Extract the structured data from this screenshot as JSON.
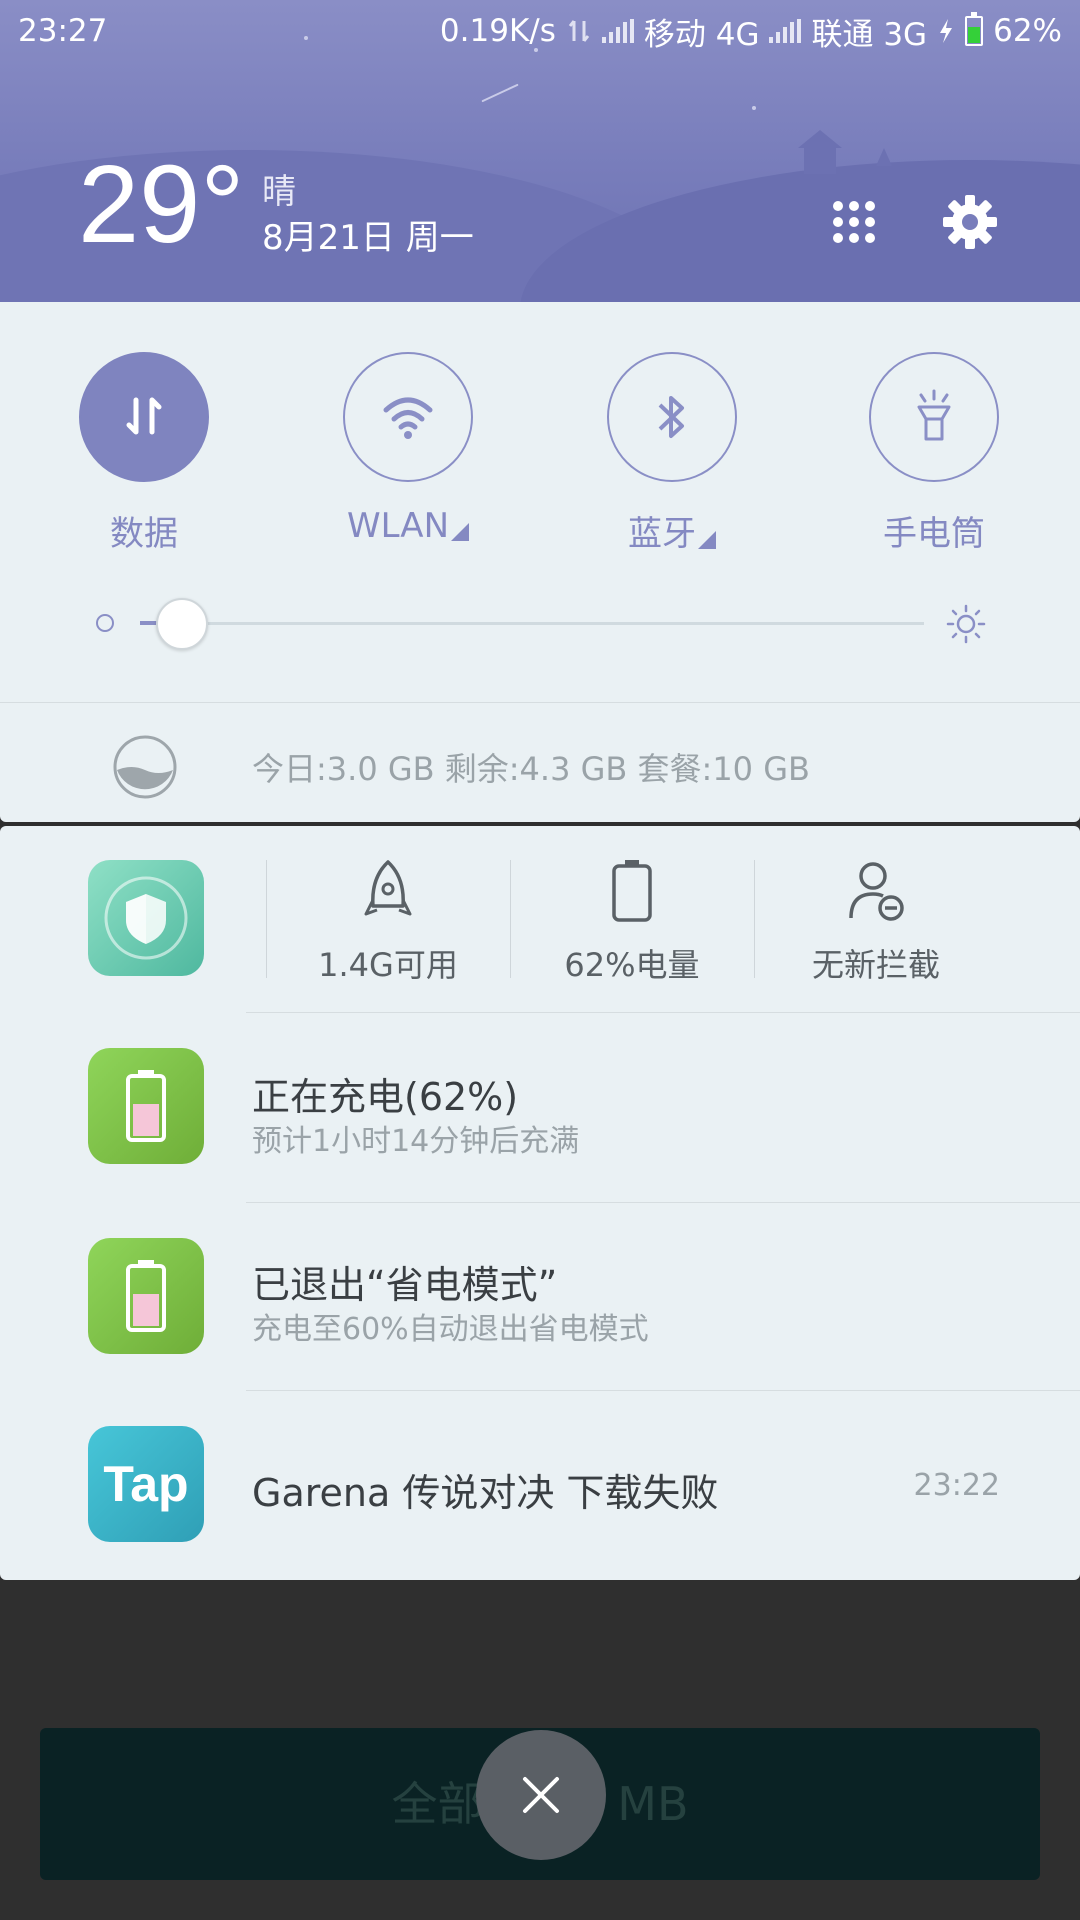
{
  "status_bar": {
    "time": "23:27",
    "speed": "0.19K/s",
    "carrier1": "移动 4G",
    "carrier2": "联通 3G",
    "battery": "62%"
  },
  "header": {
    "temperature": "29°",
    "weather": "晴",
    "date": "8月21日 周一"
  },
  "toggles": [
    {
      "label": "数据",
      "active": true
    },
    {
      "label": "WLAN",
      "active": false
    },
    {
      "label": "蓝牙",
      "active": false
    },
    {
      "label": "手电筒",
      "active": false
    }
  ],
  "brightness": {
    "level": 0.05
  },
  "data_usage": {
    "text": "今日:3.0 GB   剩余:4.3 GB   套餐:10 GB"
  },
  "shortcuts": [
    {
      "label": "1.4G可用",
      "icon": "rocket-icon"
    },
    {
      "label": "62%电量",
      "icon": "battery-icon"
    },
    {
      "label": "无新拦截",
      "icon": "user-block-icon"
    }
  ],
  "notifications": [
    {
      "title": "正在充电(62%)",
      "subtitle": "预计1小时14分钟后充满"
    },
    {
      "title": "已退出“省电模式”",
      "subtitle": "充电至60%自动退出省电模式"
    },
    {
      "title": "Garena 传说对决 下载失败",
      "time": "23:22",
      "icon_text": "Tap"
    }
  ],
  "bottom": {
    "clear_label": "全部更  44 MB"
  },
  "colors": {
    "accent": "#7f84bf",
    "panel": "#eaf1f4",
    "battery_fill": "#34d039"
  }
}
